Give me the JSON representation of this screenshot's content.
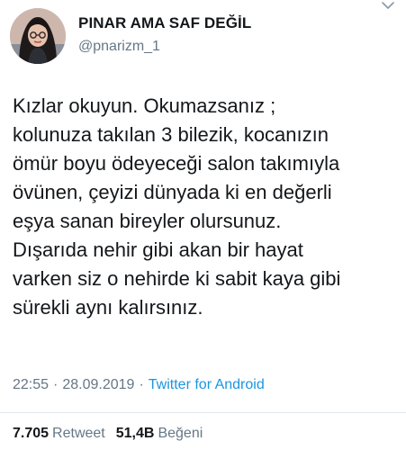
{
  "user": {
    "name": "PINAR AMA SAF DEĞİL",
    "handle": "@pnarizm_1",
    "avatar_icon": "profile-avatar"
  },
  "tweet": {
    "lines": [
      "Kızlar okuyun. Okumazsanız ;",
      "kolunuza takılan 3 bilezik, kocanızın",
      "ömür boyu ödeyeceği salon takımıyla",
      "övünen, çeyizi dünyada ki en değerli",
      "eşya sanan bireyler olursunuz.",
      "Dışarıda nehir gibi akan bir hayat",
      "varken siz o nehirde ki sabit kaya gibi",
      "sürekli aynı kalırsınız."
    ],
    "time": "22:55",
    "separator": "·",
    "date": "28.09.2019",
    "source": "Twitter for Android"
  },
  "stats": {
    "retweet_count": "7.705",
    "retweet_label": "Retweet",
    "like_count": "51,4B",
    "like_label": "Beğeni"
  },
  "colors": {
    "text": "#14171a",
    "secondary": "#657786",
    "link": "#1b95e0",
    "divider": "#e1e8ed"
  },
  "icons": {
    "menu": "chevron-down-icon"
  }
}
